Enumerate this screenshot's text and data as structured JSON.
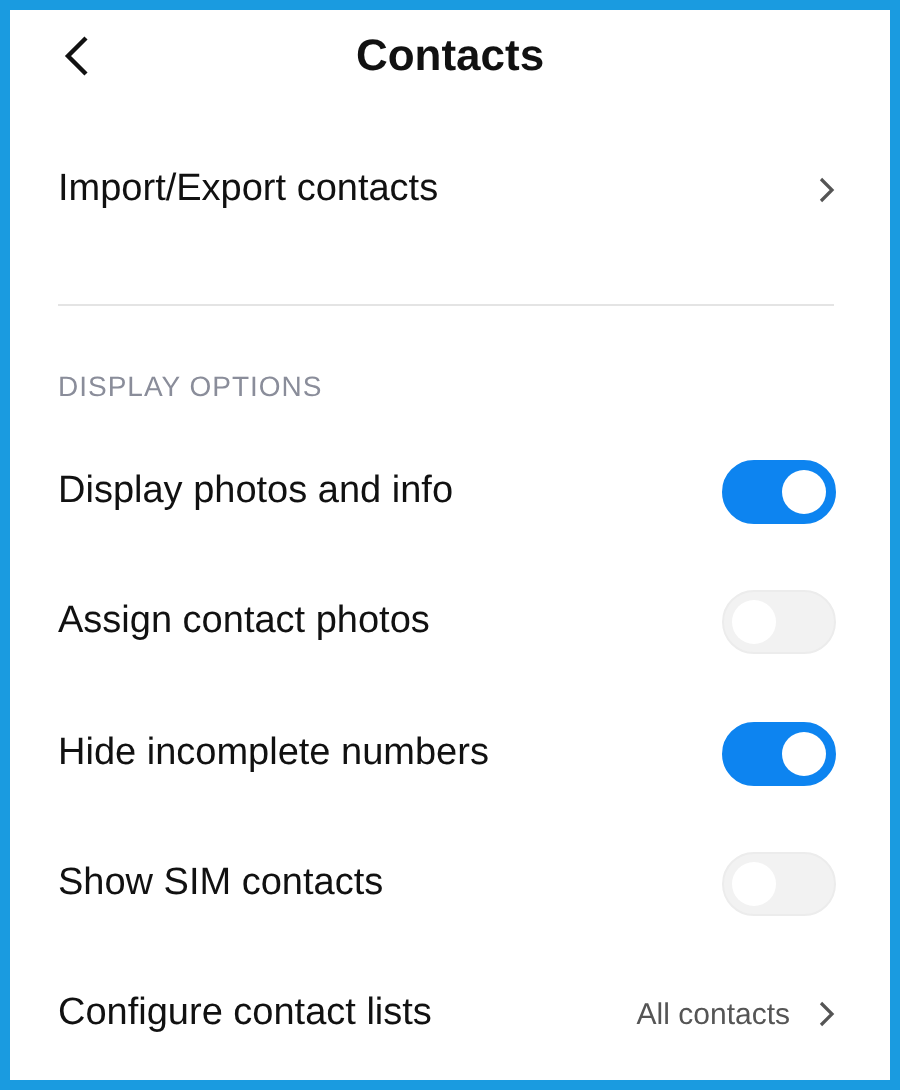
{
  "header": {
    "title": "Contacts"
  },
  "top_items": [
    {
      "label": "Import/Export contacts"
    }
  ],
  "section": {
    "title": "DISPLAY OPTIONS"
  },
  "settings": [
    {
      "kind": "toggle",
      "label": "Display photos and info",
      "on": true
    },
    {
      "kind": "toggle",
      "label": "Assign contact photos",
      "on": false
    },
    {
      "kind": "toggle",
      "label": "Hide incomplete numbers",
      "on": true
    },
    {
      "kind": "toggle",
      "label": "Show SIM contacts",
      "on": false
    },
    {
      "kind": "link",
      "label": "Configure contact lists",
      "value": "All contacts"
    }
  ]
}
